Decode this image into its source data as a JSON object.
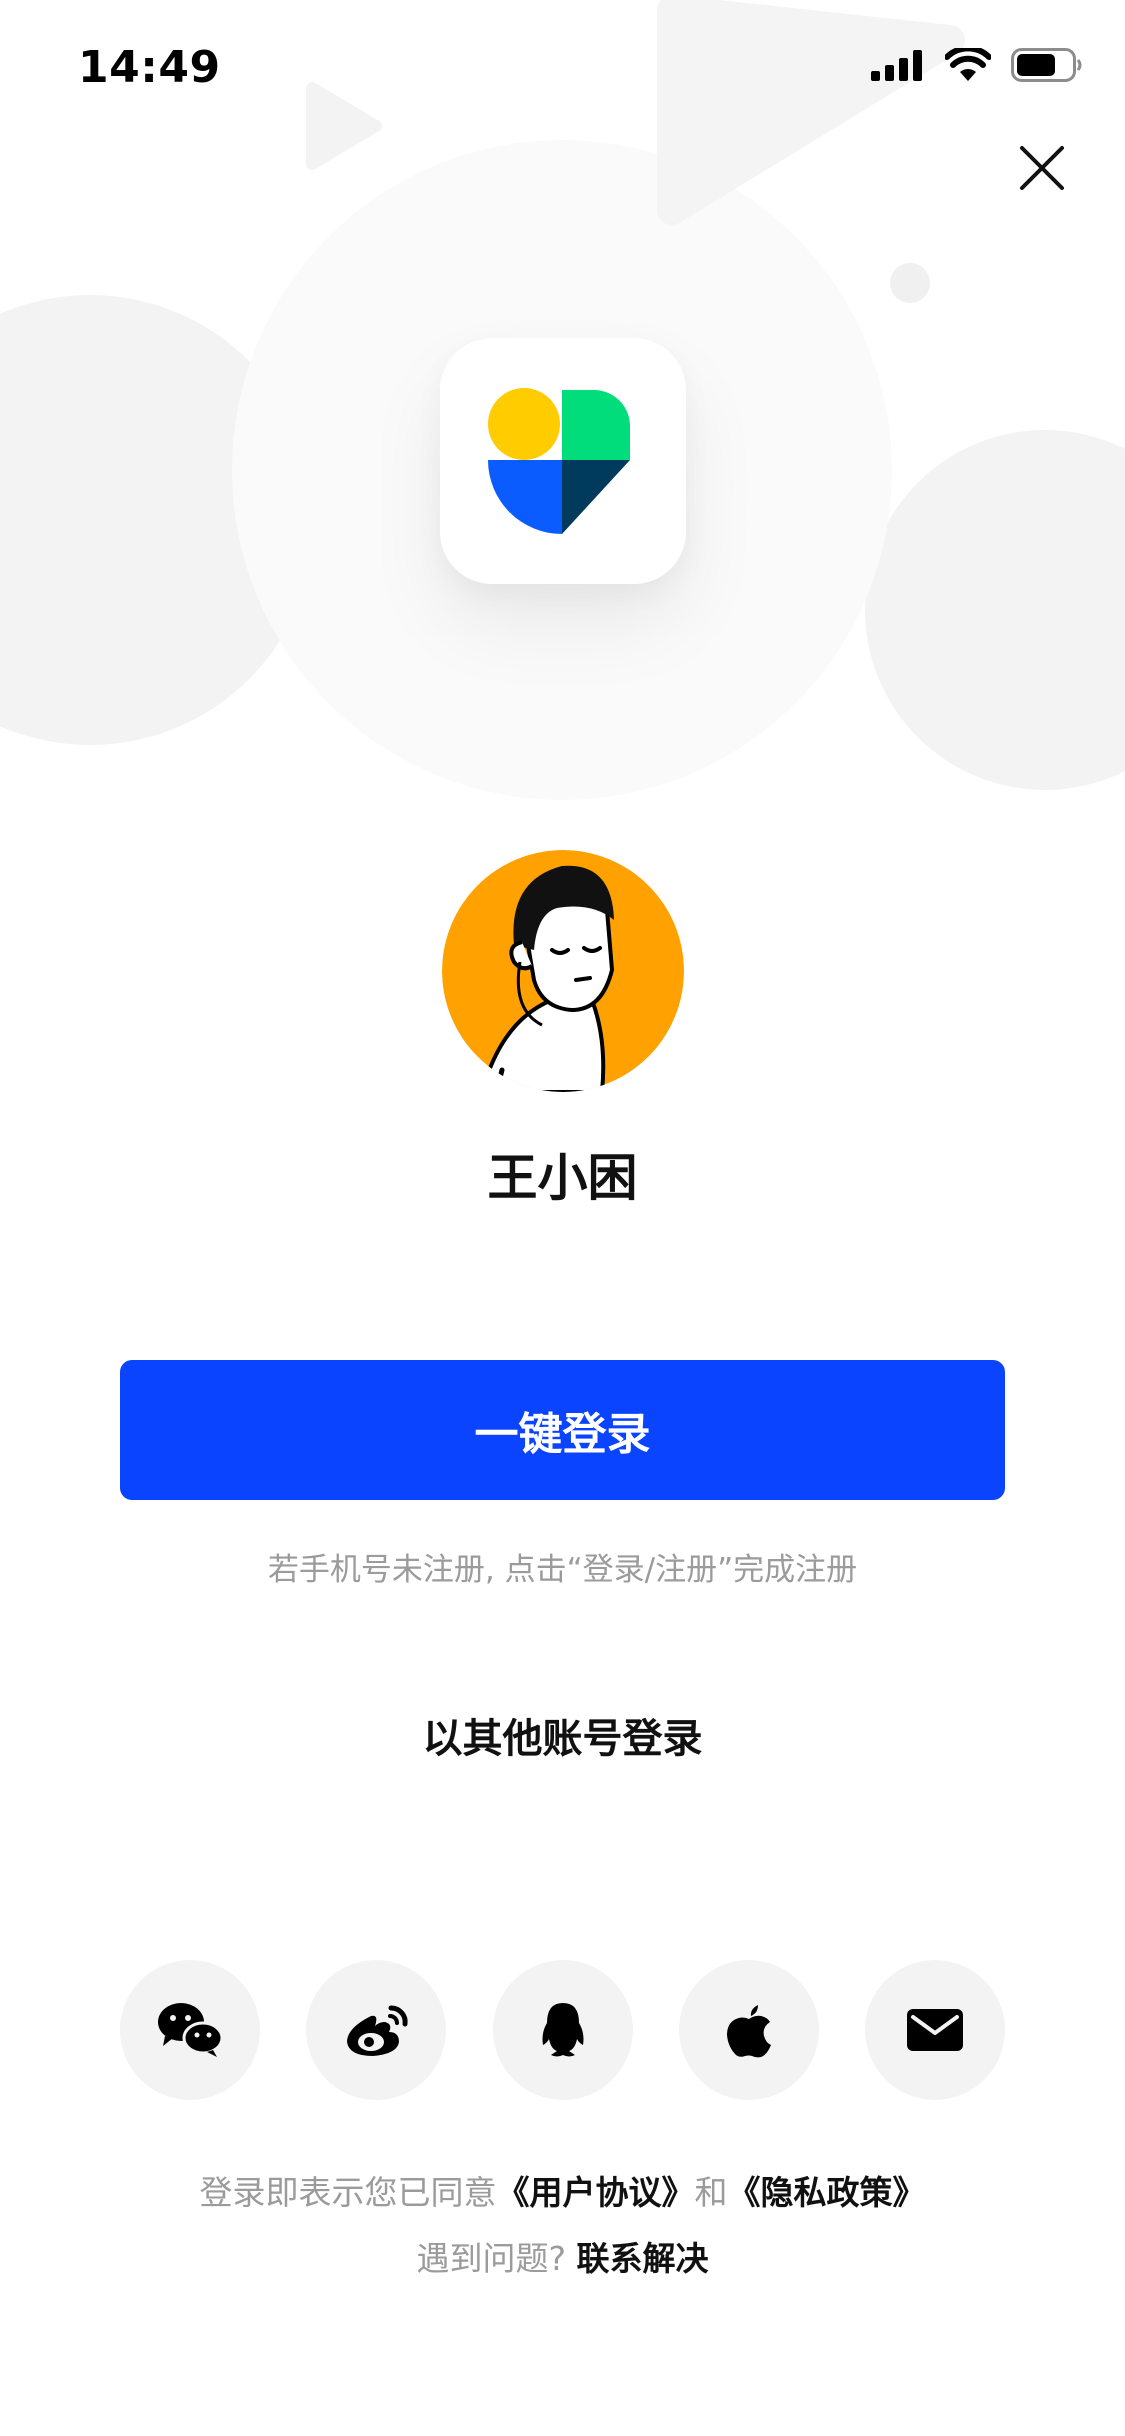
{
  "status_bar": {
    "time": "14:49",
    "icons": [
      "cellular-signal-icon",
      "wifi-icon",
      "battery-icon"
    ]
  },
  "header": {
    "close_icon": "close-icon"
  },
  "app": {
    "logo_icon": "app-heart-logo-icon",
    "colors": {
      "yellow": "#ffcc00",
      "green": "#00dd7a",
      "blue": "#0a5cff",
      "navy": "#003a5c"
    }
  },
  "profile": {
    "avatar_icon": "user-avatar-illustration",
    "avatar_bg": "#ffa100",
    "name": "王小困"
  },
  "login": {
    "one_click_label": "一键登录",
    "hint": "若手机号未注册, 点击“登录/注册”完成注册",
    "other_accounts_label": "以其他账号登录"
  },
  "social": [
    {
      "name": "wechat",
      "icon": "wechat-icon"
    },
    {
      "name": "weibo",
      "icon": "weibo-icon"
    },
    {
      "name": "qq",
      "icon": "qq-penguin-icon"
    },
    {
      "name": "apple",
      "icon": "apple-icon"
    },
    {
      "name": "email",
      "icon": "mail-icon"
    }
  ],
  "footer": {
    "agree_prefix": "登录即表示您已同意",
    "user_agreement": "《用户协议》",
    "and": "和",
    "privacy_policy": "《隐私政策》",
    "help_prefix": "遇到问题?",
    "help_link": "联系解决"
  },
  "theme": {
    "primary": "#0a44fe",
    "text_primary": "#111111",
    "text_secondary": "#9b9b9b",
    "social_bg": "#f3f3f3"
  }
}
